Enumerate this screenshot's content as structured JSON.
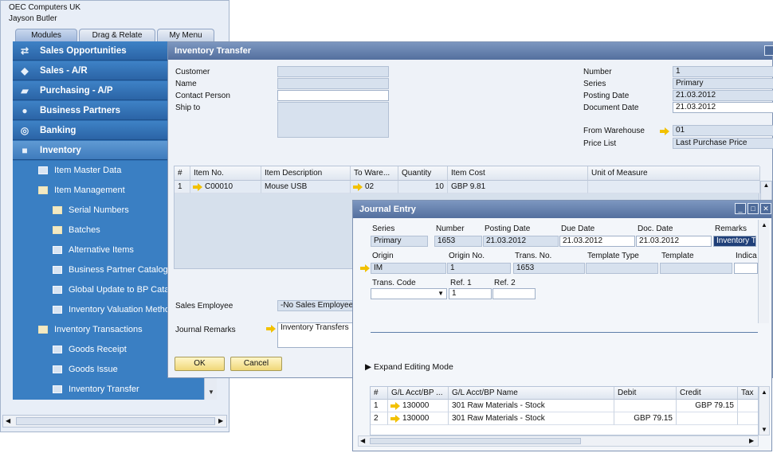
{
  "left": {
    "company": "OEC Computers UK",
    "user": "Jayson Butler",
    "tabs": [
      "Modules",
      "Drag & Relate",
      "My Menu"
    ],
    "modules": [
      {
        "label": "Sales Opportunities",
        "icon": "sales-opportunities-icon"
      },
      {
        "label": "Sales - A/R",
        "icon": "tag-icon"
      },
      {
        "label": "Purchasing - A/P",
        "icon": "cart-icon"
      },
      {
        "label": "Business Partners",
        "icon": "partners-icon"
      },
      {
        "label": "Banking",
        "icon": "coins-icon"
      },
      {
        "label": "Inventory",
        "icon": "box-icon"
      }
    ],
    "inventory_items": [
      "Item Master Data",
      "Item Management",
      "Serial Numbers",
      "Batches",
      "Alternative Items",
      "Business Partner Catalog",
      "Global Update to BP Catalog",
      "Inventory Valuation Method",
      "Inventory Transactions",
      "Goods Receipt",
      "Goods Issue",
      "Inventory Transfer"
    ]
  },
  "transfer": {
    "title": "Inventory Transfer",
    "labels": {
      "customer": "Customer",
      "name": "Name",
      "contact_person": "Contact Person",
      "ship_to": "Ship to",
      "number": "Number",
      "series": "Series",
      "posting_date": "Posting Date",
      "document_date": "Document Date",
      "from_warehouse": "From Warehouse",
      "price_list": "Price List",
      "sales_employee": "Sales Employee",
      "journal_remarks": "Journal Remarks"
    },
    "values": {
      "number": "1",
      "series": "Primary",
      "posting_date": "21.03.2012",
      "document_date": "21.03.2012",
      "from_warehouse": "01",
      "price_list": "Last Purchase Price",
      "sales_employee": "-No Sales Employee-",
      "journal_remarks": "Inventory Transfers"
    },
    "grid": {
      "headers": [
        "#",
        "Item No.",
        "Item Description",
        "To Ware...",
        "Quantity",
        "Item Cost",
        "Unit of Measure"
      ],
      "rows": [
        [
          "1",
          "C00010",
          "Mouse USB",
          "02",
          "10",
          "GBP 9.81",
          ""
        ]
      ]
    },
    "buttons": {
      "ok": "OK",
      "cancel": "Cancel"
    }
  },
  "journal": {
    "title": "Journal Entry",
    "labels": {
      "series": "Series",
      "number": "Number",
      "posting_date": "Posting Date",
      "due_date": "Due Date",
      "doc_date": "Doc. Date",
      "remarks": "Remarks",
      "origin": "Origin",
      "origin_no": "Origin No.",
      "trans_no": "Trans. No.",
      "template_type": "Template Type",
      "template": "Template",
      "indicator": "Indica",
      "trans_code": "Trans. Code",
      "ref1": "Ref. 1",
      "ref2": "Ref. 2",
      "expand": "Expand Editing Mode"
    },
    "values": {
      "series": "Primary",
      "number": "1653",
      "posting_date": "21.03.2012",
      "due_date": "21.03.2012",
      "doc_date": "21.03.2012",
      "remarks": "Inventory T",
      "origin": "IM",
      "origin_no": "1",
      "trans_no": "1653",
      "template_type": "",
      "template": "",
      "indicator": "",
      "trans_code": "",
      "ref1": "1",
      "ref2": ""
    },
    "grid": {
      "headers": [
        "#",
        "G/L Acct/BP ...",
        "G/L Acct/BP Name",
        "Debit",
        "Credit",
        "Tax"
      ],
      "rows": [
        [
          "1",
          "130000",
          "301 Raw Materials - Stock",
          "",
          "GBP 79.15",
          ""
        ],
        [
          "2",
          "130000",
          "301 Raw Materials - Stock",
          "GBP 79.15",
          "",
          ""
        ]
      ]
    }
  }
}
